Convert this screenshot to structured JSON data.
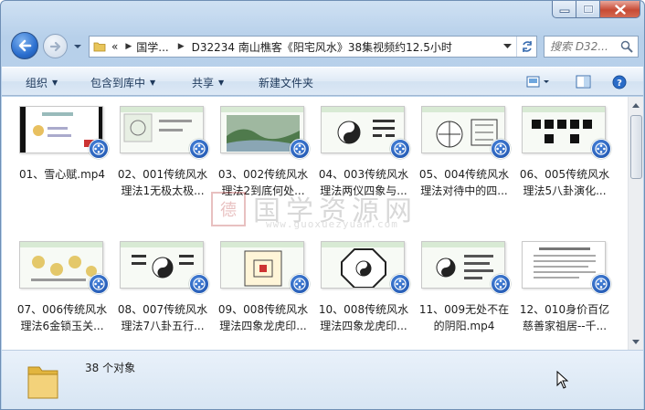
{
  "window": {
    "minimize_icon": "minimize-icon",
    "maximize_icon": "maximize-icon",
    "close_icon": "close-icon"
  },
  "address": {
    "overflow": "«",
    "crumbs": [
      "国学...",
      "D32234 南山樵客《阳宅风水》38集视频约12.5小时"
    ],
    "refresh_icon": "refresh-icon"
  },
  "search": {
    "placeholder": "搜索 D32..."
  },
  "toolbar": {
    "organize": "组织",
    "include_in_library": "包含到库中",
    "share": "共享",
    "new_folder": "新建文件夹"
  },
  "files": [
    {
      "line1": "01、雪心赋.mp4",
      "line2": ""
    },
    {
      "line1": "02、001传统风水",
      "line2": "理法1无极太极..."
    },
    {
      "line1": "03、002传统风水",
      "line2": "理法2到底何处..."
    },
    {
      "line1": "04、003传统风水",
      "line2": "理法两仪四象与..."
    },
    {
      "line1": "05、004传统风水",
      "line2": "理法对待中的四..."
    },
    {
      "line1": "06、005传统风水",
      "line2": "理法5八卦演化..."
    },
    {
      "line1": "07、006传统风水",
      "line2": "理法6金锁玉关..."
    },
    {
      "line1": "08、007传统风水",
      "line2": "理法7八卦五行..."
    },
    {
      "line1": "09、008传统风水",
      "line2": "理法四象龙虎印..."
    },
    {
      "line1": "10、008传统风水",
      "line2": "理法四象龙虎印..."
    },
    {
      "line1": "11、009无处不在",
      "line2": "的阴阳.mp4"
    },
    {
      "line1": "12、010身价百亿",
      "line2": "慈善家祖居--千..."
    }
  ],
  "status": {
    "count": "38 个对象"
  },
  "watermark": {
    "seal": "德",
    "text": "国学资源网",
    "url": "www.guoxuezyuan.com"
  },
  "colors": {
    "accent": "#2b6fcf",
    "close": "#c74b35",
    "command_text": "#1e395b"
  }
}
